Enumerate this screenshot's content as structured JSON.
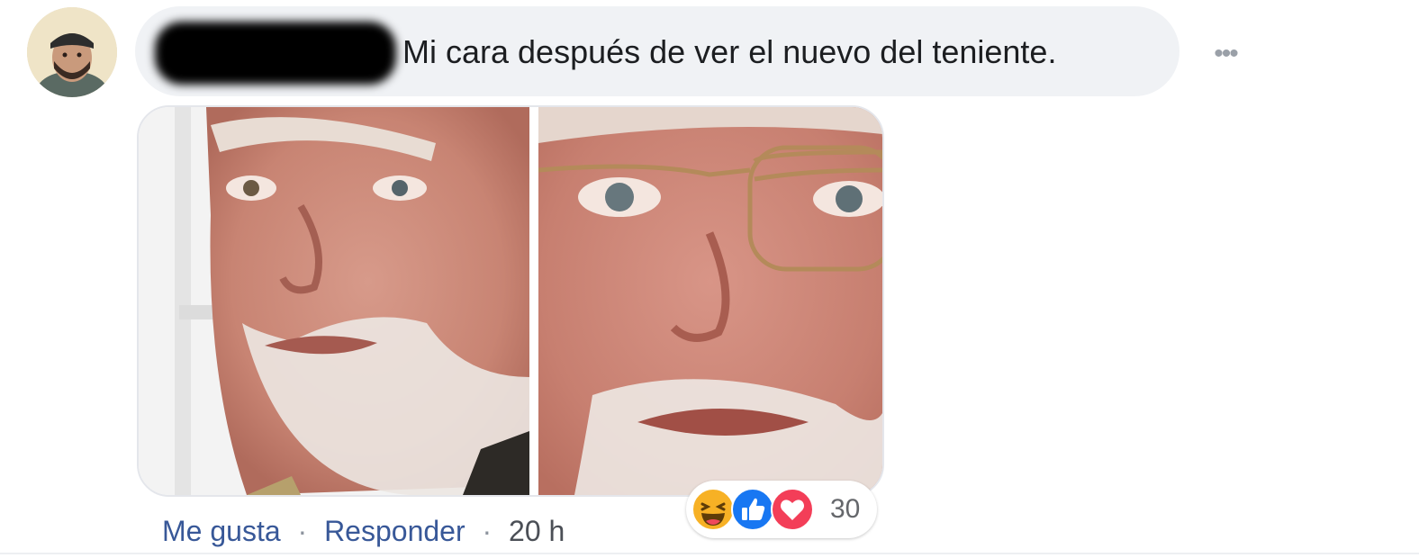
{
  "comment": {
    "text": "Mi cara después de ver el nuevo del teniente.",
    "more_icon": "ellipsis-icon"
  },
  "actions": {
    "like_label": "Me gusta",
    "separator": "·",
    "reply_label": "Responder",
    "timestamp": "20 h"
  },
  "reactions": {
    "icons": [
      "haha-icon",
      "like-icon",
      "love-icon"
    ],
    "count": "30"
  },
  "colors": {
    "bubble": "#f0f2f5",
    "link": "#385898",
    "like_blue": "#1877f2",
    "love_red": "#f33e58",
    "haha_yellow": "#f7b125"
  }
}
